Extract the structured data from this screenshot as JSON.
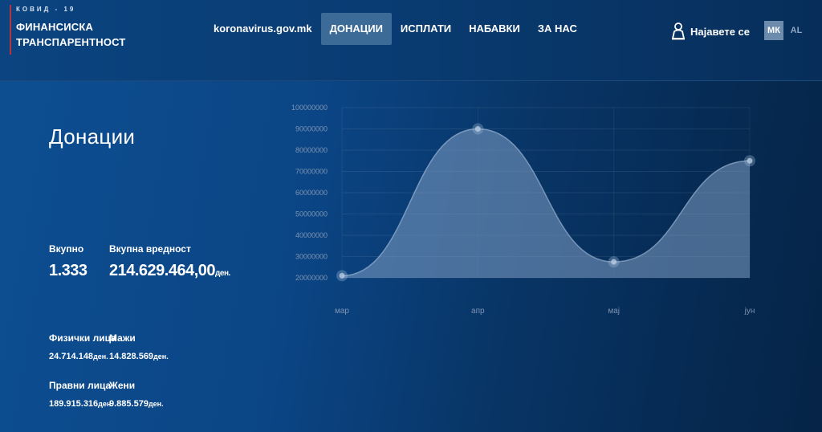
{
  "brand": {
    "subtitle": "КОВИД - 19",
    "title_line1": "ФИНАНСИСКА",
    "title_line2": "ТРАНСПАРЕНТНОСТ"
  },
  "nav": {
    "domain": "koronavirus.gov.mk",
    "donations": "ДОНАЦИИ",
    "payments": "ИСПЛАТИ",
    "procurements": "НАБАВКИ",
    "about": "ЗА НАС"
  },
  "login": {
    "label": "Најавете се",
    "icon": "user-icon"
  },
  "language": {
    "mk": "МК",
    "al": "AL",
    "selected": "МК"
  },
  "main": {
    "title": "Донации",
    "total_label": "Вкупно",
    "total_value": "1.333",
    "total_amount_label": "Вкупна вредност",
    "total_amount_value": "214.629.464,00",
    "currency": "ден.",
    "individuals_label": "Физички лица",
    "individuals_value": "24.714.148",
    "men_label": "Мажи",
    "men_value": "14.828.569",
    "legal_label": "Правни лица",
    "legal_value": "189.915.316",
    "women_label": "Жени",
    "women_value": "9.885.579"
  },
  "colors": {
    "accent_active_nav": "#3d6b98",
    "brand_bar": "#c0313a",
    "area_fill": "#7f9fc4"
  },
  "chart_data": {
    "type": "area",
    "categories": [
      "мар",
      "апр",
      "мај",
      "јун"
    ],
    "values": [
      21000000,
      90000000,
      27500000,
      75000000
    ],
    "y_ticks": [
      "100000000",
      "90000000",
      "80000000",
      "70000000",
      "60000000",
      "50000000",
      "40000000",
      "30000000",
      "20000000"
    ],
    "ylim": [
      20000000,
      100000000
    ],
    "grid": true,
    "smooth": true
  }
}
